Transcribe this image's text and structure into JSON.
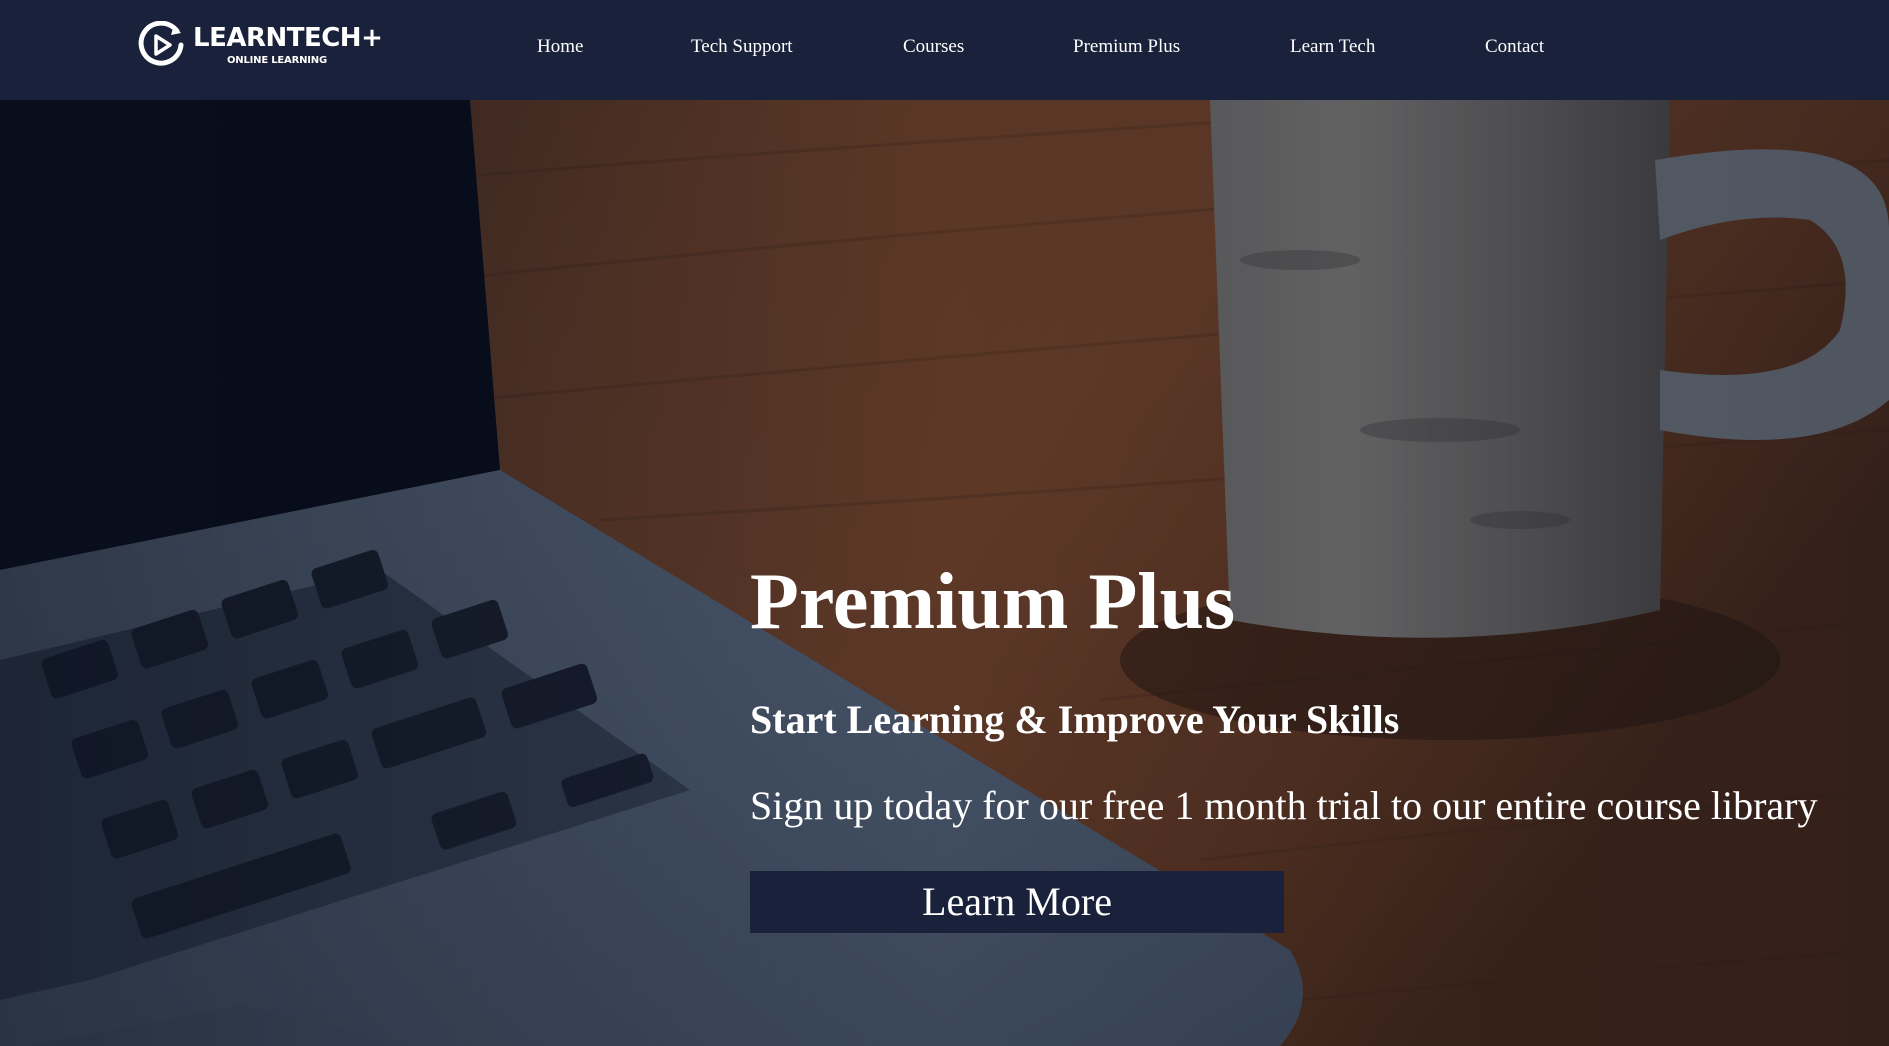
{
  "brand": {
    "name": "LEARNTECH+",
    "tagline": "ONLINE LEARNING",
    "logo_icon": "play-circle-icon"
  },
  "nav": {
    "items": [
      {
        "label": "Home"
      },
      {
        "label": "Tech Support"
      },
      {
        "label": "Courses"
      },
      {
        "label": "Premium Plus"
      },
      {
        "label": "Learn Tech"
      },
      {
        "label": "Contact"
      }
    ]
  },
  "hero": {
    "title": "Premium Plus",
    "subtitle": "Start Learning & Improve Your Skills",
    "text": "Sign up today for our free 1 month trial to our entire course library",
    "cta_label": "Learn More"
  },
  "colors": {
    "navbar_bg": "#19223a",
    "button_bg": "#19223a",
    "text": "#ffffff"
  }
}
